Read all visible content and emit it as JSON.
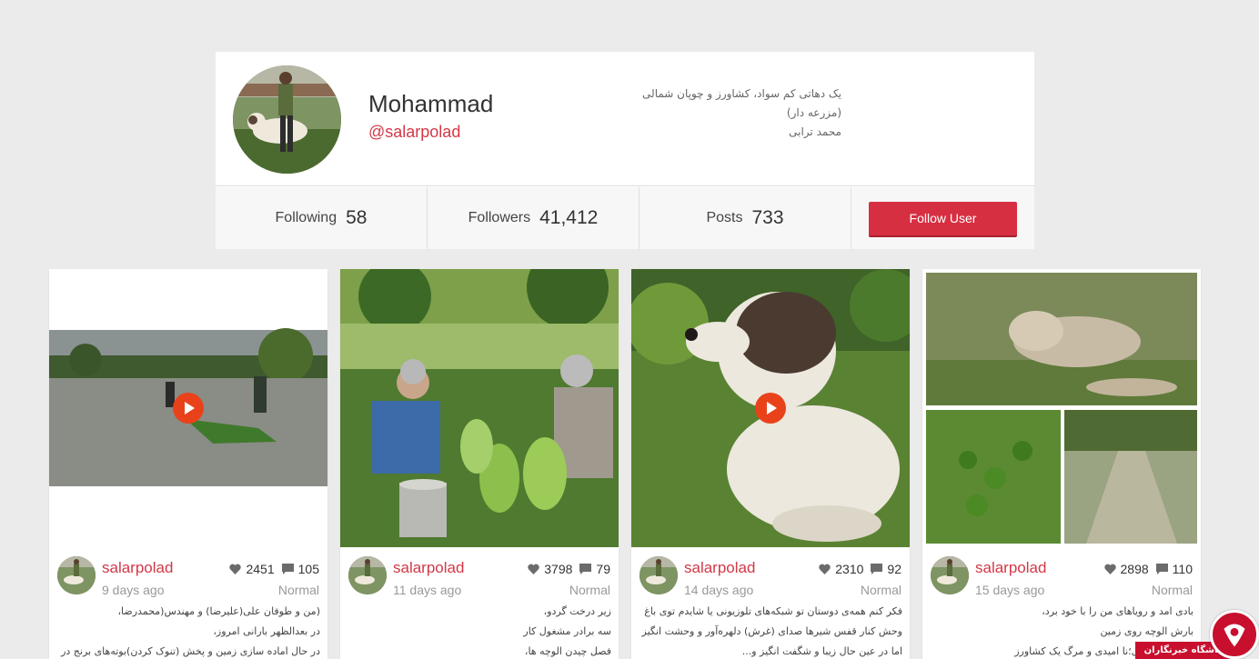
{
  "profile": {
    "name": "Mohammad",
    "handle": "@salarpolad",
    "bio": [
      "یک دهاتی کم سواد، کشاورز و چوپان شمالی",
      "(مزرعه دار)",
      "محمد ترابی"
    ]
  },
  "stats": {
    "following_label": "Following",
    "following_value": "58",
    "followers_label": "Followers",
    "followers_value": "41,412",
    "posts_label": "Posts",
    "posts_value": "733",
    "follow_button": "Follow User"
  },
  "posts": [
    {
      "user": "salarpolad",
      "time": "9 days ago",
      "likes": "2451",
      "comments": "105",
      "type": "Normal",
      "is_video": true,
      "caption": [
        "(من و طوفان علی(علیرضا) و مهندس(محمدرضا،",
        "در بعدالظهر بارانی امروز،",
        "در حال اماده سازی زمین و پخش (تنوک کردن)بوته‌های برنج در"
      ]
    },
    {
      "user": "salarpolad",
      "time": "11 days ago",
      "likes": "3798",
      "comments": "79",
      "type": "Normal",
      "is_video": false,
      "caption": [
        "زیر درخت گردو،",
        "سه برادر مشغول کار",
        "فصل چیدن الوچه ها،"
      ]
    },
    {
      "user": "salarpolad",
      "time": "14 days ago",
      "likes": "2310",
      "comments": "92",
      "type": "Normal",
      "is_video": true,
      "caption": [
        "فکر کنم همه‌ی دوستان تو شبکه‌های تلوزیونی یا شایدم توی باغ",
        "وحش کنار قفس شیرها صدای (غرش) دلهره‌آور و وحشت انگیز",
        "اما در عین حال زیبا و شگفت انگیز و..."
      ]
    },
    {
      "user": "salarpolad",
      "time": "15 days ago",
      "likes": "2898",
      "comments": "110",
      "type": "Normal",
      "is_video": false,
      "caption": [
        "بادی امد و رویاهای من را با خود برد،",
        "بارش الوچه روی زمین",
        "نابودی محصول؛نا امیدی و مرگ یک کشاورز"
      ]
    }
  ],
  "badge": {
    "text": "باشگاه خبرنگاران"
  },
  "colors": {
    "accent": "#d33847",
    "button": "#d72f42",
    "play": "#e9421a"
  }
}
